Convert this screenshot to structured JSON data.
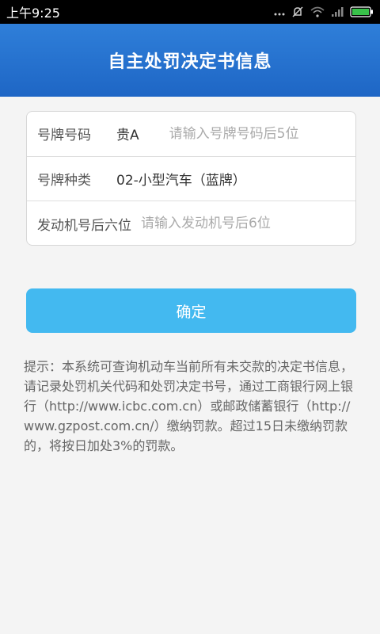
{
  "status_bar": {
    "time": "上午9:25",
    "icons": [
      "dots-icon",
      "mute-icon",
      "wifi-icon",
      "signal-icon",
      "battery-icon"
    ]
  },
  "header": {
    "title": "自主处罚决定书信息"
  },
  "form": {
    "plate_number": {
      "label": "号牌号码",
      "prefix": "贵A",
      "value": "",
      "placeholder": "请输入号牌号码后5位"
    },
    "plate_type": {
      "label": "号牌种类",
      "value": "02-小型汽车（蓝牌）"
    },
    "engine_number": {
      "label": "发动机号后六位",
      "value": "",
      "placeholder": "请输入发动机号后6位"
    }
  },
  "confirm_button": {
    "label": "确定"
  },
  "hint": {
    "text": "提示：本系统可查询机动车当前所有未交款的决定书信息，请记录处罚机关代码和处罚决定书号，通过工商银行网上银行（http://www.icbc.com.cn）或邮政储蓄银行（http://www.gzpost.com.cn/）缴纳罚款。超过15日未缴纳罚款的，将按日加处3%的罚款。"
  },
  "colors": {
    "header_bg": "#1e66c5",
    "button_bg": "#43b9f0",
    "page_bg": "#f4f4f4"
  }
}
